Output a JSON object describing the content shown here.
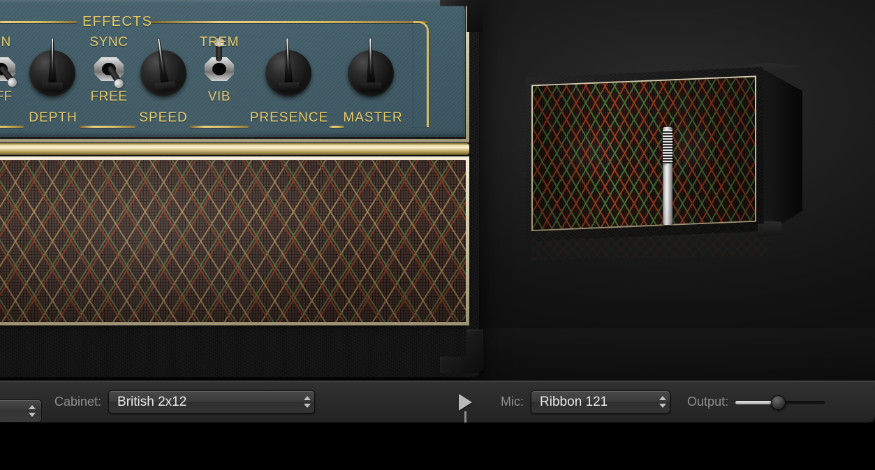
{
  "amp": {
    "panel": {
      "section_title": "EFFECTS",
      "controls": [
        {
          "name": "effects-toggle",
          "type": "toggle",
          "top_label": "ON",
          "bottom_label": "OFF",
          "position": "off",
          "angle_deg": -38
        },
        {
          "name": "depth-knob",
          "type": "knob",
          "label": "DEPTH",
          "angle_deg": 0
        },
        {
          "name": "sync-toggle",
          "type": "toggle",
          "top_label": "SYNC",
          "bottom_label": "FREE",
          "position": "free",
          "angle_deg": -32
        },
        {
          "name": "speed-knob",
          "type": "knob",
          "label": "SPEED",
          "angle_deg": -8
        },
        {
          "name": "trem-vib-toggle",
          "type": "toggle",
          "top_label": "TREM",
          "bottom_label": "VIB",
          "position": "trem",
          "angle_deg": 0
        },
        {
          "name": "presence-knob",
          "type": "knob",
          "label": "PRESENCE",
          "angle_deg": -2
        },
        {
          "name": "master-knob",
          "type": "knob",
          "label": "MASTER",
          "angle_deg": -1
        }
      ]
    },
    "colors": {
      "panel_teal": "#3f5b66",
      "gold_trim": "#d9bd62",
      "label_gold": "#e3c969",
      "grille_red": "#923c22",
      "grille_green": "#607842",
      "grille_tan": "#b6925c",
      "tolex_black": "#171717",
      "piping_cream": "#efe7cf"
    }
  },
  "cabinet_view": {
    "name": "speaker-cabinet",
    "mic_name": "ribbon-microphone",
    "has_reflection": true
  },
  "bottom_bar": {
    "amp_popup_value": "",
    "cabinet_label": "Cabinet:",
    "cabinet_value": "British 2x12",
    "play_icon": "play-triangle-icon",
    "mic_label": "Mic:",
    "mic_value": "Ribbon 121",
    "output_label": "Output:",
    "output_percent": 48,
    "stepper_up_icon": "chevron-up-icon",
    "stepper_down_icon": "chevron-down-icon"
  }
}
